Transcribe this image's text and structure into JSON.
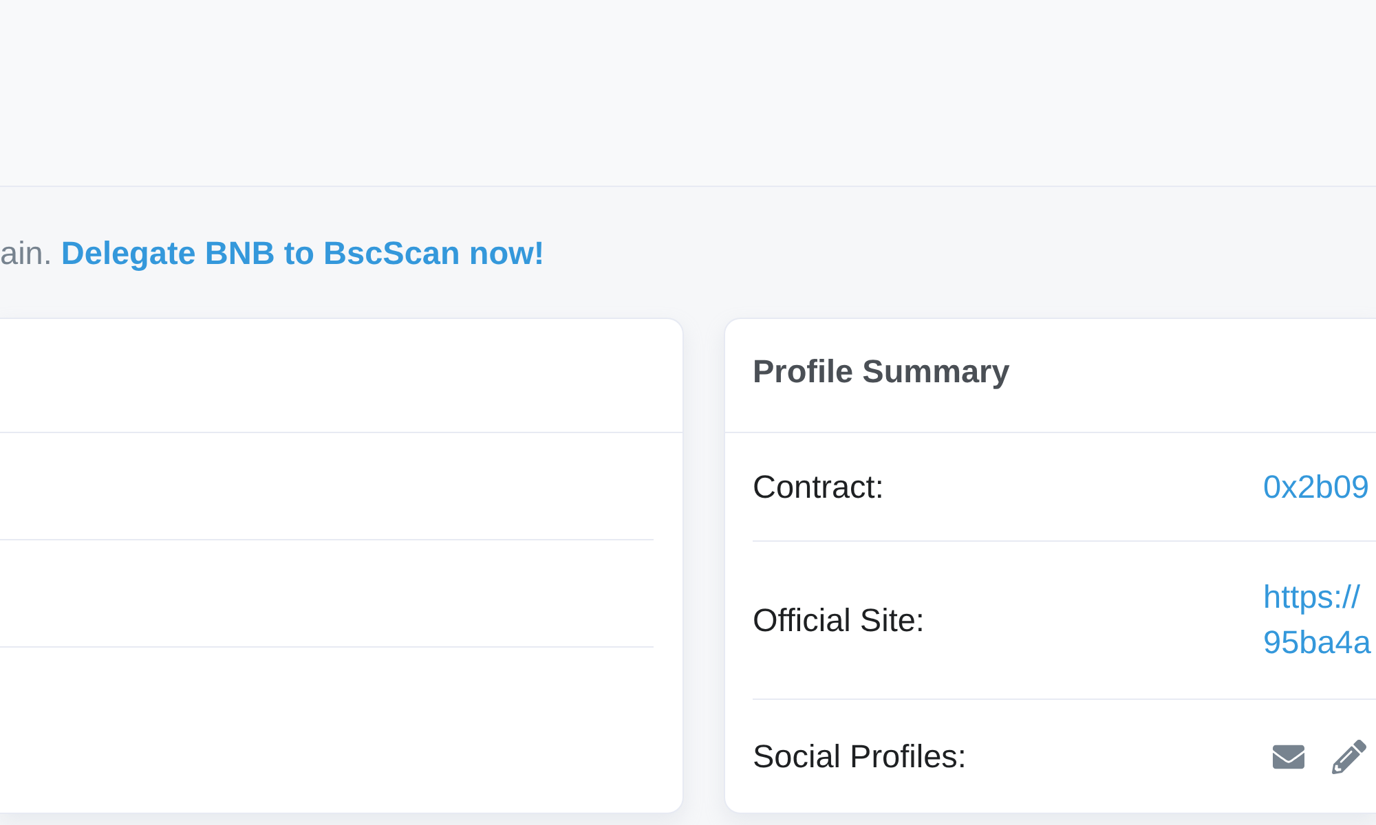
{
  "promo": {
    "text": "ain.",
    "link": "Delegate BNB to BscScan now!"
  },
  "profile_summary": {
    "title": "Profile Summary",
    "rows": [
      {
        "kind": "link",
        "label": "Contract:",
        "values": [
          "0x2b09"
        ]
      },
      {
        "kind": "link",
        "label": "Official Site:",
        "values": [
          "https://",
          "95ba4a"
        ]
      },
      {
        "kind": "social",
        "label": "Social Profiles:"
      }
    ]
  }
}
